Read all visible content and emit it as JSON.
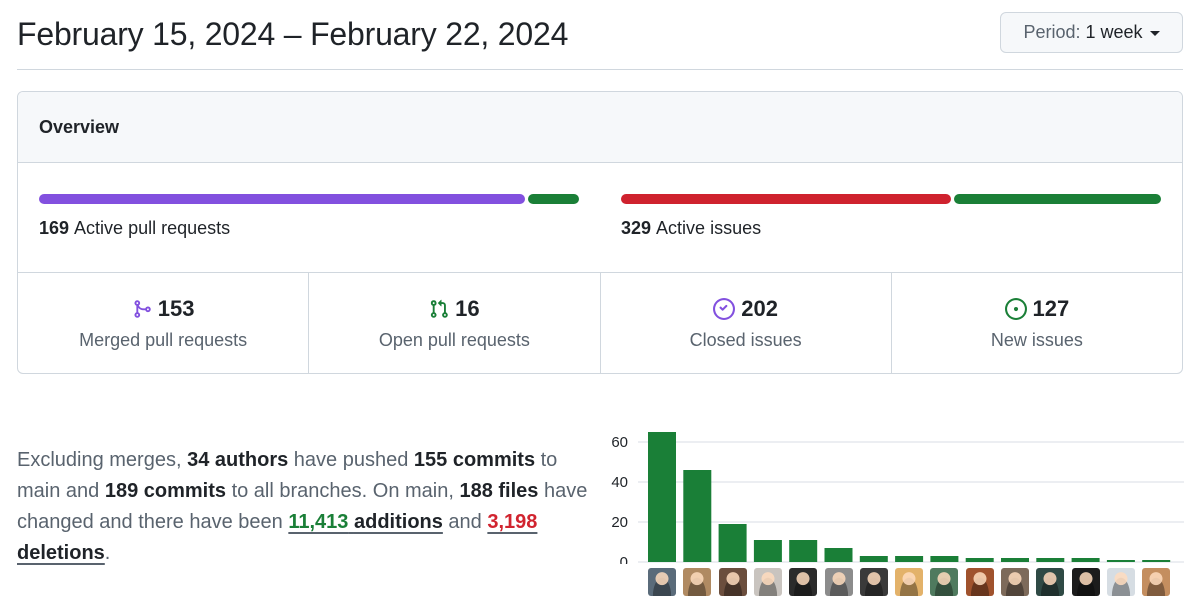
{
  "header": {
    "date_range": "February 15, 2024 – February 22, 2024",
    "period_prefix": "Period:",
    "period_value": "1 week"
  },
  "overview": {
    "title": "Overview",
    "pull_requests": {
      "count": "169",
      "label": "Active pull requests",
      "segments": [
        {
          "fraction": 0.905,
          "color": "#8250df"
        },
        {
          "fraction": 0.095,
          "color": "#1a7f37"
        }
      ]
    },
    "issues": {
      "count": "329",
      "label": "Active issues",
      "segments": [
        {
          "fraction": 0.614,
          "color": "#cf222e"
        },
        {
          "fraction": 0.386,
          "color": "#1a7f37"
        }
      ]
    },
    "stats": [
      {
        "icon": "git-merge-icon",
        "color": "#8250df",
        "value": "153",
        "label": "Merged pull requests"
      },
      {
        "icon": "git-pull-request-icon",
        "color": "#1a7f37",
        "value": "16",
        "label": "Open pull requests"
      },
      {
        "icon": "issue-closed-icon",
        "color": "#8250df",
        "value": "202",
        "label": "Closed issues"
      },
      {
        "icon": "issue-opened-icon",
        "color": "#1a7f37",
        "value": "127",
        "label": "New issues"
      }
    ]
  },
  "summary": {
    "t1": "Excluding merges, ",
    "authors": "34 authors",
    "t2": " have pushed ",
    "commits_main": "155 commits",
    "t3": " to main and ",
    "commits_all": "189 commits",
    "t4": " to all branches. On main, ",
    "files": "188 files",
    "t5": " have changed and there have been ",
    "additions_num": "11,413",
    "additions_label": "additions",
    "t6": " and ",
    "deletions_num": "3,198",
    "deletions_label": "deletions",
    "t7": "."
  },
  "chart_data": {
    "type": "bar",
    "values": [
      65,
      46,
      19,
      11,
      11,
      7,
      3,
      3,
      3,
      2,
      2,
      2,
      2,
      1,
      1
    ],
    "y_ticks": [
      "60",
      "40",
      "20",
      "0"
    ],
    "ylim": [
      0,
      66
    ],
    "grid": true,
    "bar_color": "#1a7f37"
  },
  "contributors": {
    "avatar_colors": [
      "#5a6b7a",
      "#b08a62",
      "#6b4e3d",
      "#c9c4bf",
      "#2b2b2b",
      "#8c8c8c",
      "#3a3a3a",
      "#e3b26a",
      "#4f7a5e",
      "#a0522d",
      "#7d6a5a",
      "#2f4a45",
      "#1c1c1c",
      "#d6dde3",
      "#c48e5f"
    ]
  }
}
